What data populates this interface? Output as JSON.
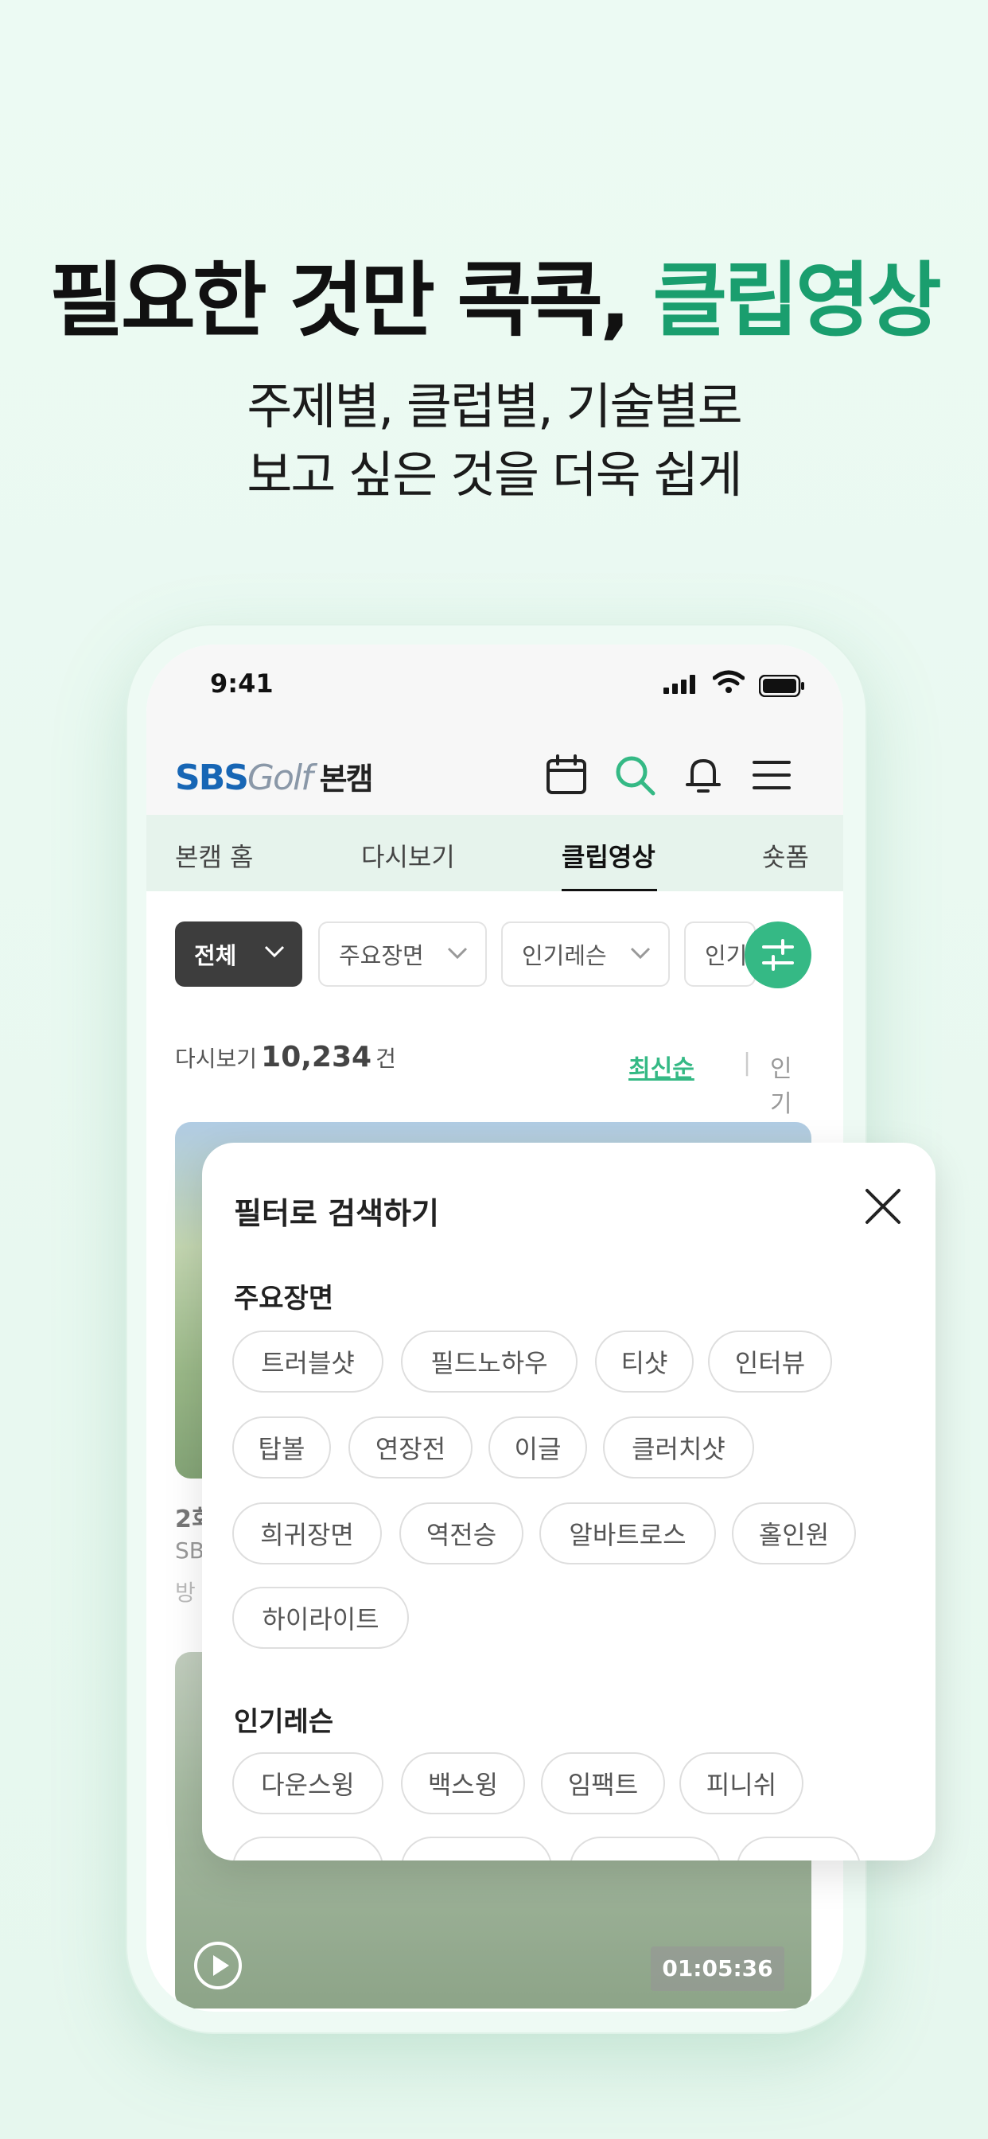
{
  "headline": {
    "part1": "필요한 것만 콕콕,",
    "part2": "클립영상"
  },
  "subline": {
    "line1": "주제별, 클럽별, 기술별로",
    "line2": "보고 싶은 것을 더욱 쉽게"
  },
  "status": {
    "time": "9:41"
  },
  "header": {
    "logo_sbs": "SBS",
    "logo_golf": "Golf",
    "logo_bon": "본캠"
  },
  "tabs": [
    "본캠 홈",
    "다시보기",
    "클립영상",
    "숏폼"
  ],
  "filters": {
    "all": "전체",
    "scene": "주요장면",
    "lesson": "인기레슨",
    "more": "인기"
  },
  "count": {
    "label": "다시보기",
    "value": "10,234",
    "unit": "건"
  },
  "sort": {
    "newest": "최신순",
    "popular": "인기순"
  },
  "video1": {
    "title_fragment": "2회",
    "channel_fragment": "SB",
    "date_fragment": "방"
  },
  "video2": {
    "duration": "01:05:36"
  },
  "sheet": {
    "title": "필터로 검색하기",
    "section1": "주요장면",
    "tags1": [
      "트러블샷",
      "필드노하우",
      "티샷",
      "인터뷰",
      "탑볼",
      "연장전",
      "이글",
      "클러치샷",
      "희귀장면",
      "역전승",
      "알바트로스",
      "홀인원",
      "하이라이트"
    ],
    "section2": "인기레슨",
    "tags2": [
      "다운스윙",
      "백스윙",
      "임팩트",
      "피니쉬"
    ]
  },
  "colors": {
    "accent": "#1a9e6e",
    "button_green": "#35b985",
    "sbs_blue": "#1766b5"
  },
  "icons": [
    "calendar-icon",
    "search-icon",
    "bell-icon",
    "menu-icon",
    "filter-icon",
    "close-icon",
    "play-icon"
  ]
}
